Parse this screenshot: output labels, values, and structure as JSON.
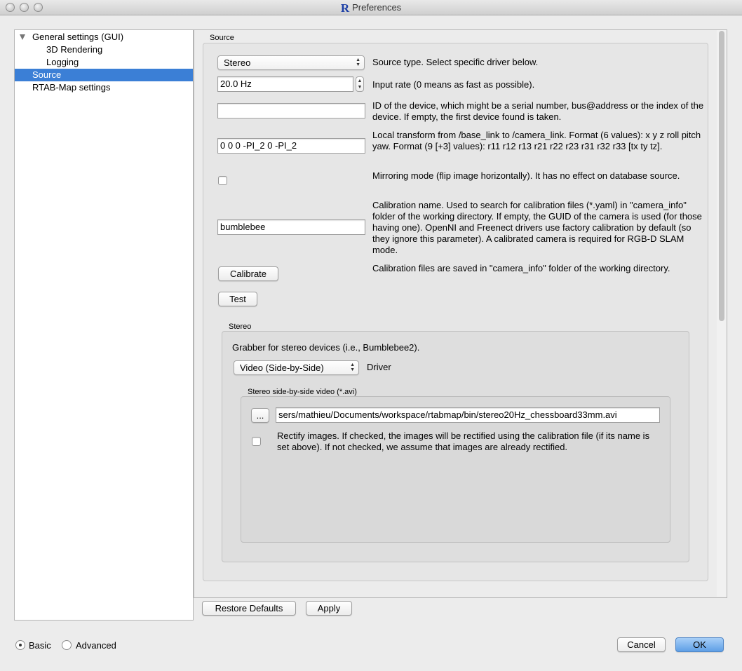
{
  "window": {
    "title": "Preferences"
  },
  "sidebar": {
    "items": [
      {
        "label": "General settings (GUI)"
      },
      {
        "label": "3D Rendering"
      },
      {
        "label": "Logging"
      },
      {
        "label": "Source"
      },
      {
        "label": "RTAB-Map settings"
      }
    ]
  },
  "source": {
    "group_title": "Source",
    "source_type": {
      "value": "Stereo",
      "desc": "Source type. Select specific driver below."
    },
    "input_rate": {
      "value": "20.0 Hz",
      "desc": "Input rate (0 means as fast as possible)."
    },
    "device_id": {
      "value": "",
      "desc": "ID of the device, which might be a serial number, bus@address or the index of the device. If empty, the first device found is taken."
    },
    "local_transform": {
      "value": "0 0 0 -PI_2 0 -PI_2",
      "desc": "Local transform from /base_link to /camera_link. Format (6 values): x y z roll pitch yaw. Format (9 [+3] values): r11 r12 r13 r21 r22 r23 r31 r32 r33 [tx ty tz]."
    },
    "mirroring": {
      "checked": false,
      "desc": "Mirroring mode (flip image horizontally). It has no effect on database source."
    },
    "calibration_name": {
      "value": "bumblebee",
      "desc": "Calibration name. Used to search for calibration files (*.yaml) in \"camera_info\" folder of the working directory. If empty, the GUID of the camera is used (for those having one). OpenNI and Freenect drivers use factory calibration by default (so they ignore this parameter). A calibrated camera is required for RGB-D SLAM mode."
    },
    "calibrate": {
      "label": "Calibrate",
      "desc": "Calibration files are saved in \"camera_info\" folder of the working directory."
    },
    "test": {
      "label": "Test"
    }
  },
  "stereo": {
    "group_title": "Stereo",
    "desc": "Grabber for stereo devices (i.e., Bumblebee2).",
    "driver": {
      "value": "Video (Side-by-Side)",
      "label": "Driver"
    },
    "video": {
      "group_title": "Stereo side-by-side video (*.avi)",
      "browse_label": "...",
      "path": "sers/mathieu/Documents/workspace/rtabmap/bin/stereo20Hz_chessboard33mm.avi",
      "rectify": {
        "checked": false,
        "desc": "Rectify images. If checked, the images will be rectified using the calibration file (if its name is set above). If not checked, we assume that images are already rectified."
      }
    }
  },
  "buttons": {
    "restore_defaults": "Restore Defaults",
    "apply": "Apply",
    "cancel": "Cancel",
    "ok": "OK"
  },
  "mode": {
    "basic": "Basic",
    "advanced": "Advanced",
    "selected": "Basic"
  },
  "colors": {
    "selection": "#3b7fd6",
    "default_button": "#5e9fe6",
    "logo": "#1c3fa6"
  }
}
